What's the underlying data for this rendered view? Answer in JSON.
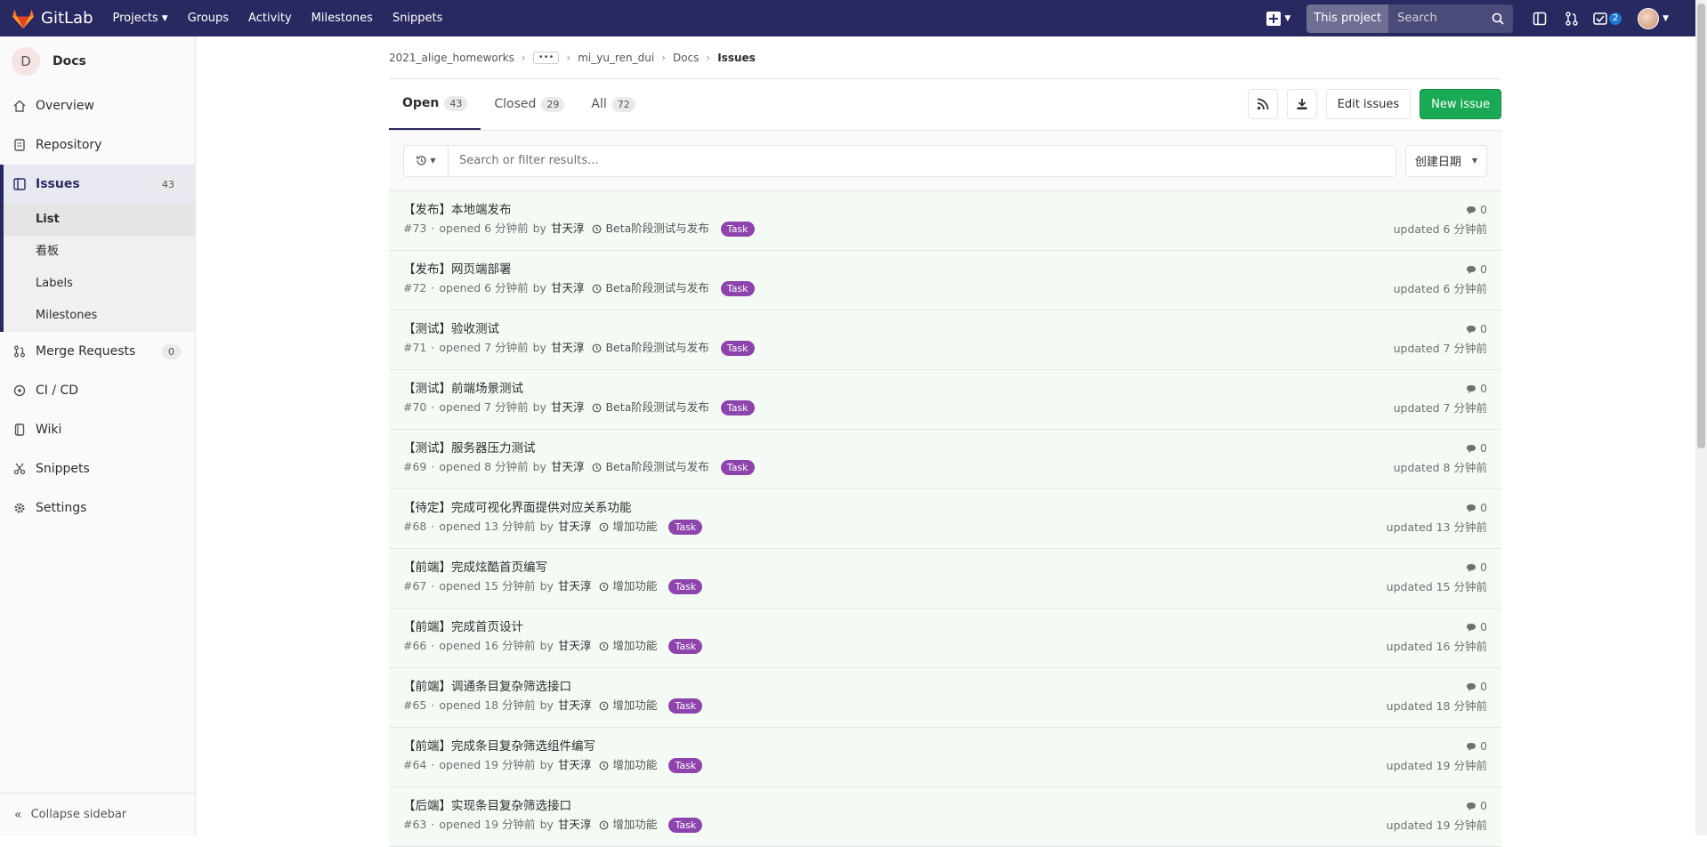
{
  "navbar": {
    "brand": "GitLab",
    "links": [
      {
        "label": "Projects",
        "has_dropdown": true
      },
      {
        "label": "Groups"
      },
      {
        "label": "Activity"
      },
      {
        "label": "Milestones"
      },
      {
        "label": "Snippets"
      }
    ],
    "search_scope": "This project",
    "search_placeholder": "Search",
    "todo_count": "2"
  },
  "sidebar": {
    "project_letter": "D",
    "project_name": "Docs",
    "items": [
      {
        "label": "Overview",
        "icon": "home-icon"
      },
      {
        "label": "Repository",
        "icon": "doc-icon"
      },
      {
        "label": "Issues",
        "icon": "issues-icon",
        "count": "43",
        "active": true
      },
      {
        "label": "Merge Requests",
        "icon": "merge-icon",
        "count": "0"
      },
      {
        "label": "CI / CD",
        "icon": "rocket-icon"
      },
      {
        "label": "Wiki",
        "icon": "book-icon"
      },
      {
        "label": "Snippets",
        "icon": "scissors-icon"
      },
      {
        "label": "Settings",
        "icon": "gear-icon"
      }
    ],
    "issues_sub": [
      "List",
      "看板",
      "Labels",
      "Milestones"
    ],
    "collapse_label": "Collapse sidebar"
  },
  "breadcrumb": [
    "2021_alige_homeworks",
    "mi_yu_ren_dui",
    "Docs",
    "Issues"
  ],
  "tabs": [
    {
      "label": "Open",
      "count": "43"
    },
    {
      "label": "Closed",
      "count": "29"
    },
    {
      "label": "All",
      "count": "72"
    }
  ],
  "actions": {
    "edit": "Edit issues",
    "new": "New issue"
  },
  "filter": {
    "placeholder": "Search or filter results...",
    "sort": "创建日期"
  },
  "colors": {
    "navbar": "#292961",
    "label_task": "#8e44ad",
    "new_issue": "#1aaa55",
    "issue_bg": "#f4fbf4"
  },
  "issues": [
    {
      "title": "【发布】本地端发布",
      "ref": "#73",
      "opened": "opened 6 分钟前",
      "author": "甘天淳",
      "milestone": "Beta阶段测试与发布",
      "label": "Task",
      "comments": "0",
      "updated": "updated 6 分钟前"
    },
    {
      "title": "【发布】网页端部署",
      "ref": "#72",
      "opened": "opened 6 分钟前",
      "author": "甘天淳",
      "milestone": "Beta阶段测试与发布",
      "label": "Task",
      "comments": "0",
      "updated": "updated 6 分钟前"
    },
    {
      "title": "【测试】验收测试",
      "ref": "#71",
      "opened": "opened 7 分钟前",
      "author": "甘天淳",
      "milestone": "Beta阶段测试与发布",
      "label": "Task",
      "comments": "0",
      "updated": "updated 7 分钟前"
    },
    {
      "title": "【测试】前端场景测试",
      "ref": "#70",
      "opened": "opened 7 分钟前",
      "author": "甘天淳",
      "milestone": "Beta阶段测试与发布",
      "label": "Task",
      "comments": "0",
      "updated": "updated 7 分钟前"
    },
    {
      "title": "【测试】服务器压力测试",
      "ref": "#69",
      "opened": "opened 8 分钟前",
      "author": "甘天淳",
      "milestone": "Beta阶段测试与发布",
      "label": "Task",
      "comments": "0",
      "updated": "updated 8 分钟前"
    },
    {
      "title": "【待定】完成可视化界面提供对应关系功能",
      "ref": "#68",
      "opened": "opened 13 分钟前",
      "author": "甘天淳",
      "milestone": "增加功能",
      "label": "Task",
      "comments": "0",
      "updated": "updated 13 分钟前"
    },
    {
      "title": "【前端】完成炫酷首页编写",
      "ref": "#67",
      "opened": "opened 15 分钟前",
      "author": "甘天淳",
      "milestone": "增加功能",
      "label": "Task",
      "comments": "0",
      "updated": "updated 15 分钟前"
    },
    {
      "title": "【前端】完成首页设计",
      "ref": "#66",
      "opened": "opened 16 分钟前",
      "author": "甘天淳",
      "milestone": "增加功能",
      "label": "Task",
      "comments": "0",
      "updated": "updated 16 分钟前"
    },
    {
      "title": "【前端】调通条目复杂筛选接口",
      "ref": "#65",
      "opened": "opened 18 分钟前",
      "author": "甘天淳",
      "milestone": "增加功能",
      "label": "Task",
      "comments": "0",
      "updated": "updated 18 分钟前"
    },
    {
      "title": "【前端】完成条目复杂筛选组件编写",
      "ref": "#64",
      "opened": "opened 19 分钟前",
      "author": "甘天淳",
      "milestone": "增加功能",
      "label": "Task",
      "comments": "0",
      "updated": "updated 19 分钟前"
    },
    {
      "title": "【后端】实现条目复杂筛选接口",
      "ref": "#63",
      "opened": "opened 19 分钟前",
      "author": "甘天淳",
      "milestone": "增加功能",
      "label": "Task",
      "comments": "0",
      "updated": "updated 19 分钟前"
    }
  ]
}
